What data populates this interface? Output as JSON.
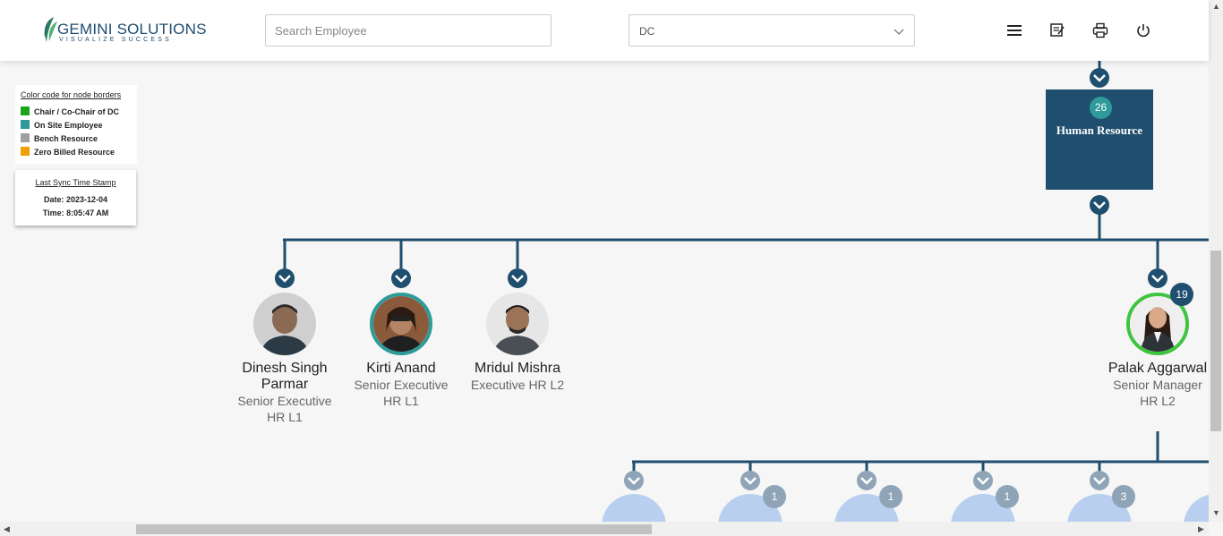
{
  "header": {
    "logo_main": "GEMINI SOLUTIONS",
    "logo_tagline": "VISUALIZE SUCCESS",
    "search_placeholder": "Search Employee",
    "dept_select_value": "DC",
    "icons": [
      "menu-icon",
      "notes-icon",
      "print-icon",
      "power-icon"
    ]
  },
  "legend": {
    "title": "Color code for node borders",
    "items": [
      {
        "label": "Chair / Co-Chair of DC",
        "color": "#1aa51a"
      },
      {
        "label": "On Site Employee",
        "color": "#2e9a9a"
      },
      {
        "label": "Bench Resource",
        "color": "#a0a0a0"
      },
      {
        "label": "Zero Billed Resource",
        "color": "#f0a000"
      }
    ]
  },
  "sync": {
    "title": "Last Sync Time Stamp",
    "date": "Date: 2023-12-04",
    "time": "Time: 8:05:47 AM"
  },
  "department_node": {
    "count": "26",
    "title": "Human Resource",
    "color": "#1f4e6e",
    "count_color": "#2e9a9a"
  },
  "employees": [
    {
      "name_lines": [
        "Dinesh Singh",
        "Parmar"
      ],
      "role_lines": [
        "Senior Executive",
        "HR L1"
      ],
      "border": "none"
    },
    {
      "name_lines": [
        "Kirti Anand"
      ],
      "role_lines": [
        "Senior Executive",
        "HR L1"
      ],
      "border": "#2e9a9a"
    },
    {
      "name_lines": [
        "Mridul Mishra"
      ],
      "role_lines": [
        "Executive HR L2"
      ],
      "border": "none"
    },
    {
      "name_lines": [
        "Palak Aggarwal"
      ],
      "role_lines": [
        "Senior Manager",
        "HR L2"
      ],
      "border": "#3ec43e",
      "badge": "19"
    }
  ],
  "sub_nodes": [
    {
      "badge": ""
    },
    {
      "badge": "1"
    },
    {
      "badge": "1"
    },
    {
      "badge": "1"
    },
    {
      "badge": "3"
    },
    {
      "badge": ""
    }
  ],
  "colors": {
    "connector": "#1f4e6e",
    "background": "#f6f6f6",
    "sub_node": "#b8cff0",
    "sub_badge": "#8fa5b7"
  }
}
